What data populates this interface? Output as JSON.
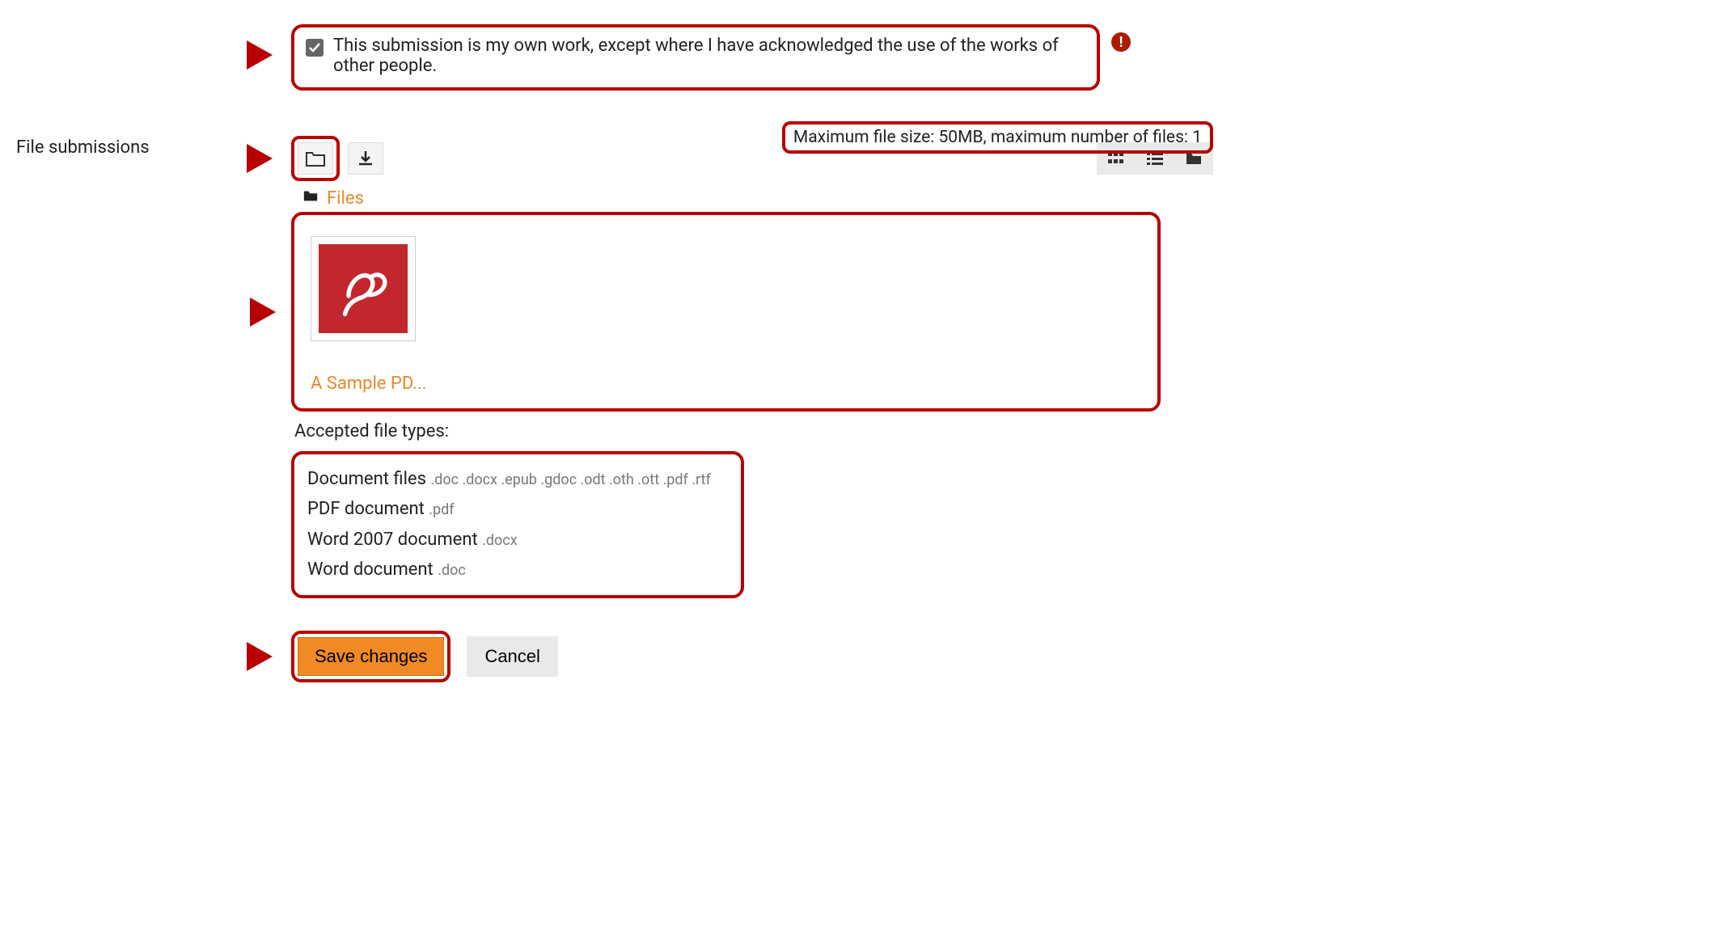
{
  "declaration": {
    "text": "This submission is my own work, except where I have acknowledged the use of the works of other people.",
    "checked": true
  },
  "section_label": "File submissions",
  "limits_text": "Maximum file size: 50MB, maximum number of files: 1",
  "breadcrumb": "Files",
  "file": {
    "name": "A Sample PD..."
  },
  "accepted_label": "Accepted file types:",
  "types": [
    {
      "label": "Document files ",
      "ext": ".doc .docx .epub .gdoc .odt .oth .ott .pdf .rtf"
    },
    {
      "label": "PDF document ",
      "ext": ".pdf"
    },
    {
      "label": "Word 2007 document ",
      "ext": ".docx"
    },
    {
      "label": "Word document ",
      "ext": ".doc"
    }
  ],
  "buttons": {
    "save": "Save changes",
    "cancel": "Cancel"
  }
}
